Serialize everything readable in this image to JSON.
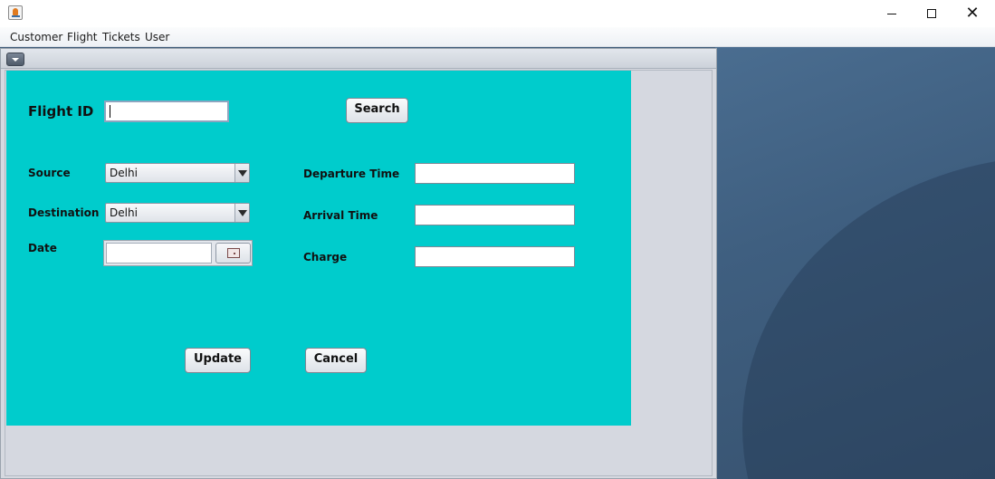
{
  "window": {
    "close_glyph": "✕"
  },
  "menu": {
    "items": [
      "Customer",
      "Flight",
      "Tickets",
      "User"
    ]
  },
  "form": {
    "flight_id_label": "Flight ID",
    "flight_id_value": "",
    "search_label": "Search",
    "source_label": "Source",
    "source_value": "Delhi",
    "destination_label": "Destination",
    "destination_value": "Delhi",
    "date_label": "Date",
    "date_value": "",
    "departure_label": "Departure Time",
    "departure_value": "",
    "arrival_label": "Arrival Time",
    "arrival_value": "",
    "charge_label": "Charge",
    "charge_value": "",
    "update_label": "Update",
    "cancel_label": "Cancel"
  },
  "colors": {
    "panel": "#00cccc",
    "desktop": "#3e5a78",
    "frame_body": "#d5d8e0"
  }
}
